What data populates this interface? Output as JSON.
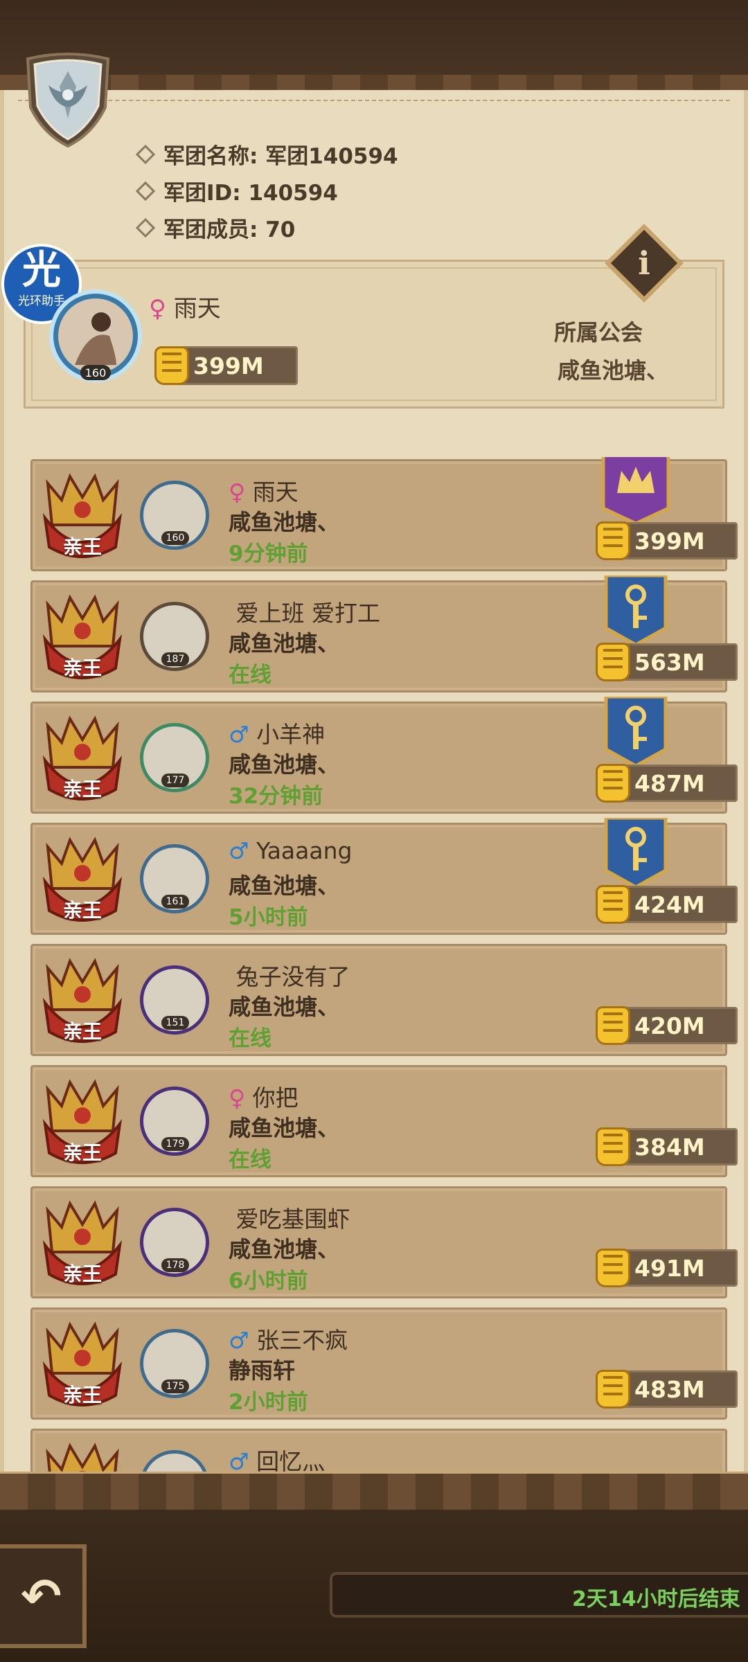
{
  "header": {
    "name_label": "军团名称: 军团140594",
    "id_label": "军团ID: 140594",
    "members_label": "军团成员: 70"
  },
  "watermark": {
    "glyph": "光",
    "text": "光环助手"
  },
  "leader": {
    "gender": "female",
    "gender_symbol": "♀",
    "name": "雨天",
    "level": "160",
    "power": "399M",
    "guild_label": "所属公会",
    "guild_name": "咸鱼池塘、"
  },
  "info_button": {
    "glyph": "i"
  },
  "rank_label": "亲王",
  "members": [
    {
      "gender_symbol": "♀",
      "gender": "female",
      "name": "雨天",
      "guild": "咸鱼池塘、",
      "status": "9分钟前",
      "level": "160",
      "power": "399M",
      "banner": "crown"
    },
    {
      "gender_symbol": "",
      "gender": "",
      "name": "爱上班 爱打工",
      "guild": "咸鱼池塘、",
      "status": "在线",
      "level": "187",
      "power": "563M",
      "banner": "key"
    },
    {
      "gender_symbol": "♂",
      "gender": "male",
      "name": "小羊神",
      "guild": "咸鱼池塘、",
      "status": "32分钟前",
      "level": "177",
      "power": "487M",
      "banner": "key"
    },
    {
      "gender_symbol": "♂",
      "gender": "male",
      "name": "Yaaaang",
      "guild": "咸鱼池塘、",
      "status": "5小时前",
      "level": "161",
      "power": "424M",
      "banner": "key"
    },
    {
      "gender_symbol": "",
      "gender": "",
      "name": "兔子没有了",
      "guild": "咸鱼池塘、",
      "status": "在线",
      "level": "151",
      "power": "420M",
      "banner": ""
    },
    {
      "gender_symbol": "♀",
      "gender": "female",
      "name": "你把",
      "guild": "咸鱼池塘、",
      "status": "在线",
      "level": "179",
      "power": "384M",
      "banner": ""
    },
    {
      "gender_symbol": "",
      "gender": "",
      "name": "爱吃基围虾",
      "guild": "咸鱼池塘、",
      "status": "6小时前",
      "level": "178",
      "power": "491M",
      "banner": ""
    },
    {
      "gender_symbol": "♂",
      "gender": "male",
      "name": "张三不疯",
      "guild": "静雨轩",
      "status": "2小时前",
      "level": "175",
      "power": "483M",
      "banner": ""
    },
    {
      "gender_symbol": "♂",
      "gender": "male",
      "name": "回忆灬",
      "guild": "",
      "status": "",
      "level": "",
      "power": "",
      "banner": ""
    }
  ],
  "footer": {
    "back_glyph": "↶",
    "timer_text": "2天14小时后结束"
  },
  "colors": {
    "online": "#5fa033",
    "female": "#d9468f",
    "male": "#2a7fd4",
    "power_text": "#fff3c8"
  }
}
